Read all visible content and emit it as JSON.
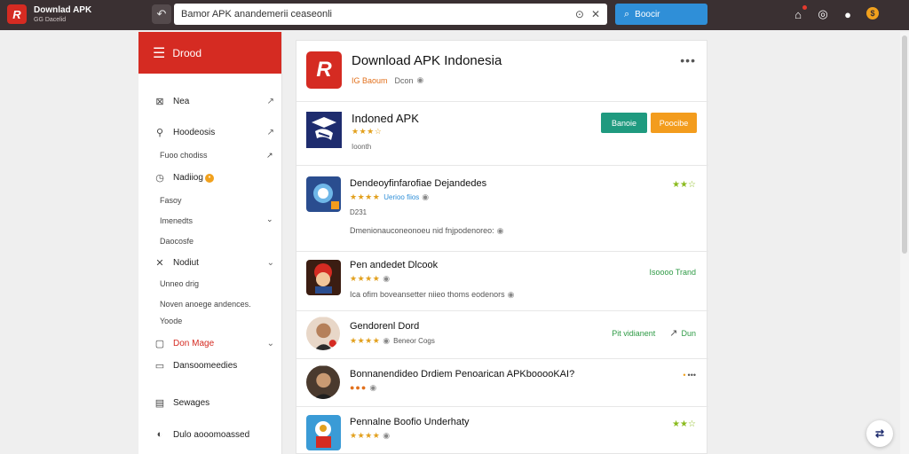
{
  "brand": {
    "logo_letter": "R",
    "title": "Downlad APK",
    "subtitle": "GG Dacelid"
  },
  "search": {
    "value": "Bamor APK anandemerii ceaseonli",
    "button_label": "Boocir"
  },
  "colors": {
    "brand_red": "#d52b22",
    "topbar": "#3a3032",
    "search_blue": "#2f8fd8",
    "green": "#1f9a7f",
    "orange": "#f39c1d"
  },
  "sidebar": {
    "header": "Drood",
    "items": [
      {
        "icon": "inbox-icon",
        "label": "Nea",
        "tail": "↗"
      },
      {
        "icon": "wrench-icon",
        "label": "Hoodeosis",
        "tail": "↗"
      },
      {
        "sub": "Fuoo chodiss",
        "tail": "↗"
      },
      {
        "icon": "clock-icon",
        "label": "Nadiiog",
        "badge": "•"
      },
      {
        "sub": "Fasoy"
      },
      {
        "sub": "Imenedts",
        "tail": "⌄"
      },
      {
        "sub": "Daocosfe"
      },
      {
        "icon": "tools-icon",
        "label": "Nodiut",
        "tail": "⌄"
      },
      {
        "sub": "Unneo drig"
      },
      {
        "sub": "Noven anoege andences."
      },
      {
        "sub": "Yoode"
      },
      {
        "icon": "folder-icon",
        "label": "Don Mage",
        "tail": "⌄",
        "red": true
      },
      {
        "icon": "message-icon",
        "label": "Dansoomeedies"
      },
      {
        "icon": "document-icon",
        "label": "Sewages"
      },
      {
        "icon": "circle-icon",
        "label": "Dulo aooomoassed"
      }
    ]
  },
  "hero": {
    "logo_letter": "R",
    "title": "Download APK Indonesia",
    "meta_orange": "IG Baoum",
    "meta_gray": "Dcon",
    "more": "•••"
  },
  "featured": {
    "title": "Indoned APK",
    "stars": "★★★☆",
    "meta": "Ioonth",
    "button_green": "Banoie",
    "button_orange": "Poocibe"
  },
  "apps": [
    {
      "title": "Dendeoyfinfarofiae Dejandedes",
      "stars": "★★★★",
      "sub": "Uerioo fiios",
      "extra": "D231",
      "desc": "Dmenionauconeonoeu nid fnjpodenoreo:",
      "right_stars": "★★☆"
    },
    {
      "title": "Pen andedet Dlcook",
      "stars": "★★★★",
      "desc": "Ica ofim boveansetter niieo thoms eodenors",
      "right_text": "Isoooo Trand"
    },
    {
      "title": "Gendorenl Dord",
      "stars": "★★★★",
      "sub": "Beneor Cogs",
      "right_text": "Pit vidianent",
      "right_link": "Dun"
    },
    {
      "title": "Bonnanendideo Drdiem Penoarican APKbooooKAI?",
      "dots": "●●●",
      "right_more": "•••"
    },
    {
      "title": "Pennalne Boofio Underhaty",
      "stars": "★★★★",
      "right_stars": "★★☆"
    }
  ]
}
